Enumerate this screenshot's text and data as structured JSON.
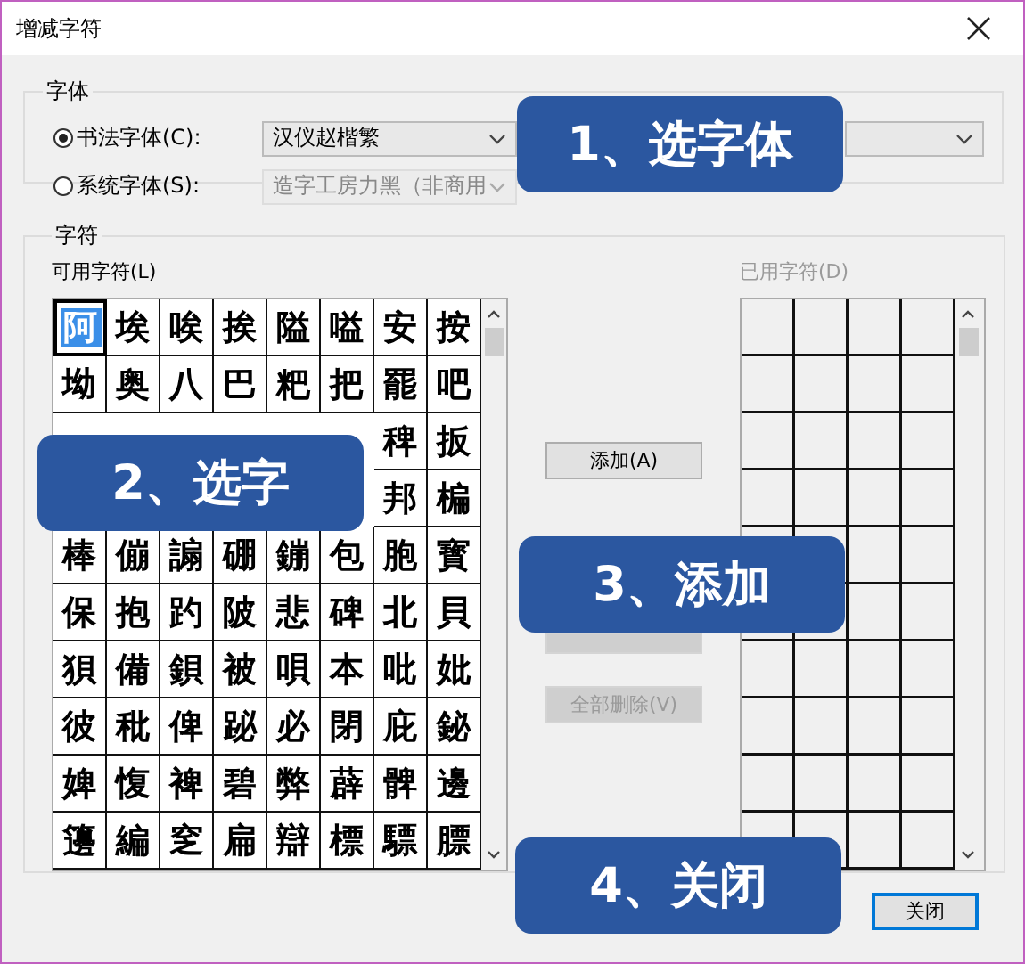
{
  "window": {
    "title": "增减字符"
  },
  "font_group": {
    "label": "字体",
    "options": [
      {
        "label": "书法字体(C):",
        "selected": true,
        "dropdown": {
          "value": "汉仪赵楷繁",
          "disabled": false
        }
      },
      {
        "label": "系统字体(S):",
        "selected": false,
        "dropdown": {
          "value": "造字工房力黑（非商用",
          "disabled": true
        }
      }
    ]
  },
  "char_group": {
    "label": "字符",
    "available": {
      "label": "可用字符(L)",
      "rows": [
        [
          {
            "kind": "glyph",
            "char": "阿",
            "selected": true
          },
          {
            "kind": "glyph",
            "char": "埃",
            "selected": false
          },
          {
            "kind": "glyph",
            "char": "唉",
            "selected": false
          },
          {
            "kind": "glyph",
            "char": "挨",
            "selected": false
          },
          {
            "kind": "glyph",
            "char": "隘",
            "selected": false
          },
          {
            "kind": "glyph",
            "char": "嗌",
            "selected": false
          },
          {
            "kind": "glyph",
            "char": "安",
            "selected": false
          },
          {
            "kind": "glyph",
            "char": "按",
            "selected": false
          }
        ],
        [
          {
            "kind": "glyph",
            "char": "坳",
            "selected": false
          },
          {
            "kind": "glyph",
            "char": "奥",
            "selected": false
          },
          {
            "kind": "glyph",
            "char": "八",
            "selected": false
          },
          {
            "kind": "glyph",
            "char": "巴",
            "selected": false
          },
          {
            "kind": "glyph",
            "char": "粑",
            "selected": false
          },
          {
            "kind": "glyph",
            "char": "把",
            "selected": false
          },
          {
            "kind": "glyph",
            "char": "罷",
            "selected": false
          },
          {
            "kind": "glyph",
            "char": "吧",
            "selected": false
          }
        ],
        [
          {
            "kind": "glyph",
            "char": "稗",
            "selected": false
          },
          {
            "kind": "glyph",
            "char": "扳",
            "selected": false
          }
        ],
        [
          {
            "kind": "glyph",
            "char": "邦",
            "selected": false
          },
          {
            "kind": "glyph",
            "char": "楄",
            "selected": false
          }
        ],
        [
          {
            "kind": "glyph",
            "char": "棒",
            "selected": false
          },
          {
            "kind": "glyph",
            "char": "傰",
            "selected": false
          },
          {
            "kind": "glyph",
            "char": "謆",
            "selected": false
          },
          {
            "kind": "glyph",
            "char": "硼",
            "selected": false
          },
          {
            "kind": "glyph",
            "char": "鏰",
            "selected": false
          },
          {
            "kind": "glyph",
            "char": "包",
            "selected": false
          },
          {
            "kind": "glyph",
            "char": "胞",
            "selected": false
          },
          {
            "kind": "glyph",
            "char": "寳",
            "selected": false
          }
        ],
        [
          {
            "kind": "glyph",
            "char": "保",
            "selected": false
          },
          {
            "kind": "glyph",
            "char": "抱",
            "selected": false
          },
          {
            "kind": "glyph",
            "char": "趵",
            "selected": false
          },
          {
            "kind": "glyph",
            "char": "陂",
            "selected": false
          },
          {
            "kind": "glyph",
            "char": "悲",
            "selected": false
          },
          {
            "kind": "glyph",
            "char": "碑",
            "selected": false
          },
          {
            "kind": "glyph",
            "char": "北",
            "selected": false
          },
          {
            "kind": "glyph",
            "char": "貝",
            "selected": false
          }
        ],
        [
          {
            "kind": "glyph",
            "char": "狽",
            "selected": false
          },
          {
            "kind": "glyph",
            "char": "備",
            "selected": false
          },
          {
            "kind": "glyph",
            "char": "鋇",
            "selected": false
          },
          {
            "kind": "glyph",
            "char": "被",
            "selected": false
          },
          {
            "kind": "glyph",
            "char": "唄",
            "selected": false
          },
          {
            "kind": "glyph",
            "char": "本",
            "selected": false
          },
          {
            "kind": "glyph",
            "char": "吡",
            "selected": false
          },
          {
            "kind": "glyph",
            "char": "妣",
            "selected": false
          }
        ],
        [
          {
            "kind": "glyph",
            "char": "彼",
            "selected": false
          },
          {
            "kind": "glyph",
            "char": "秕",
            "selected": false
          },
          {
            "kind": "glyph",
            "char": "俾",
            "selected": false
          },
          {
            "kind": "glyph",
            "char": "䟤",
            "selected": false
          },
          {
            "kind": "glyph",
            "char": "必",
            "selected": false
          },
          {
            "kind": "glyph",
            "char": "閉",
            "selected": false
          },
          {
            "kind": "glyph",
            "char": "庇",
            "selected": false
          },
          {
            "kind": "glyph",
            "char": "鉍",
            "selected": false
          }
        ],
        [
          {
            "kind": "glyph",
            "char": "婢",
            "selected": false
          },
          {
            "kind": "glyph",
            "char": "愎",
            "selected": false
          },
          {
            "kind": "glyph",
            "char": "裨",
            "selected": false
          },
          {
            "kind": "glyph",
            "char": "碧",
            "selected": false
          },
          {
            "kind": "glyph",
            "char": "弊",
            "selected": false
          },
          {
            "kind": "glyph",
            "char": "薜",
            "selected": false
          },
          {
            "kind": "glyph",
            "char": "髀",
            "selected": false
          },
          {
            "kind": "glyph",
            "char": "邊",
            "selected": false
          }
        ],
        [
          {
            "kind": "glyph",
            "char": "籩",
            "selected": false
          },
          {
            "kind": "glyph",
            "char": "編",
            "selected": false
          },
          {
            "kind": "glyph",
            "char": "窆",
            "selected": false
          },
          {
            "kind": "glyph",
            "char": "扁",
            "selected": false
          },
          {
            "kind": "glyph",
            "char": "辯",
            "selected": false
          },
          {
            "kind": "glyph",
            "char": "標",
            "selected": false
          },
          {
            "kind": "glyph",
            "char": "驃",
            "selected": false
          },
          {
            "kind": "glyph",
            "char": "膘",
            "selected": false
          }
        ]
      ]
    },
    "used": {
      "label": "已用字符(D)",
      "disabled": true
    },
    "buttons": [
      {
        "label": "添加(A)",
        "disabled": false
      },
      {
        "disabled": true
      },
      {
        "label": "全部删除(V)",
        "disabled": true
      }
    ]
  },
  "close_button": {
    "label": "关闭",
    "default": true
  },
  "callouts": [
    "1、选字体",
    "2、选字",
    "3、添加",
    "4、关闭"
  ]
}
